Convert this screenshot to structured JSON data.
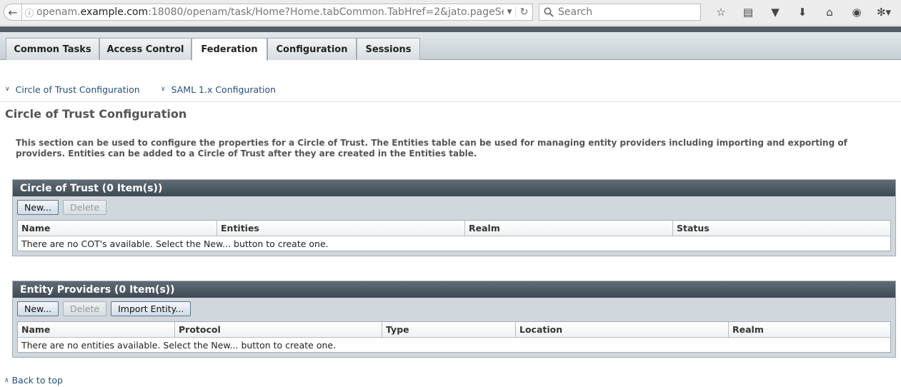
{
  "browser": {
    "url_host_prefix": "openam.",
    "url_host_domain": "example.com",
    "url_rest": ":18080/openam/task/Home?Home.tabCommon.TabHref=2&jato.pageSes",
    "search_placeholder": "Search"
  },
  "tabs": [
    {
      "label": "Common Tasks"
    },
    {
      "label": "Access Control"
    },
    {
      "label": "Federation"
    },
    {
      "label": "Configuration"
    },
    {
      "label": "Sessions"
    }
  ],
  "subnav": [
    {
      "label": "Circle of Trust Configuration"
    },
    {
      "label": "SAML 1.x Configuration"
    }
  ],
  "page": {
    "title": "Circle of Trust Configuration",
    "help_text": "This section can be used to configure the properties for a Circle of Trust. The Entities table can be used for managing entity providers including importing and exporting of providers. Entities can be added to a Circle of Trust after they are created in the Entities table.",
    "back_to_top": "Back to top"
  },
  "cot_table": {
    "title": "Circle of Trust (0 Item(s))",
    "new_label": "New...",
    "delete_label": "Delete",
    "columns": [
      "Name",
      "Entities",
      "Realm",
      "Status"
    ],
    "empty_message": "There are no COT's available. Select the New... button to create one."
  },
  "entity_table": {
    "title": "Entity Providers (0 Item(s))",
    "new_label": "New...",
    "delete_label": "Delete",
    "import_label": "Import Entity...",
    "columns": [
      "Name",
      "Protocol",
      "Type",
      "Location",
      "Realm"
    ],
    "empty_message": "There are no entities available. Select the New... button to create one."
  },
  "icons": {
    "back": "back-arrow-icon",
    "info": "site-info-icon",
    "reload": "reload-icon",
    "search": "search-icon",
    "toolbar": [
      "star-icon",
      "reading-list-icon",
      "pocket-icon",
      "download-icon",
      "home-icon",
      "chat-icon",
      "extension-icon"
    ]
  },
  "colors": {
    "link": "#25507c",
    "panel_header": "#3f4a53",
    "panel_bg": "#d0d8de"
  }
}
